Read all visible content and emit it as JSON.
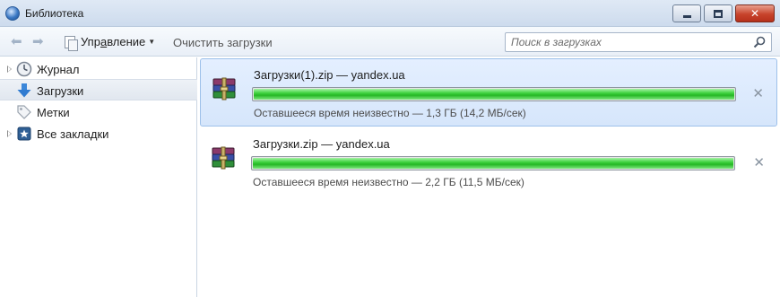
{
  "window": {
    "title": "Библиотека"
  },
  "toolbar": {
    "back_icon": "arrow-left-icon",
    "forward_icon": "arrow-right-icon",
    "manage_label": "Упр",
    "manage_label_underlined": "а",
    "manage_label_rest": "вление",
    "clear_label": "Очистить загрузки",
    "search_placeholder": "Поиск в загрузках"
  },
  "sidebar": {
    "items": [
      {
        "label": "Журнал",
        "icon": "clock-icon",
        "expandable": true,
        "selected": false
      },
      {
        "label": "Загрузки",
        "icon": "download-arrow-icon",
        "expandable": false,
        "selected": true
      },
      {
        "label": "Метки",
        "icon": "tag-icon",
        "expandable": false,
        "selected": false
      },
      {
        "label": "Все закладки",
        "icon": "star-bookmark-icon",
        "expandable": true,
        "selected": false
      }
    ]
  },
  "downloads": [
    {
      "name": "Загрузки(1).zip — yandex.ua",
      "status": "Оставшееся время неизвестно — 1,3 ГБ (14,2 МБ/сек)",
      "progress": 1.0,
      "selected": true,
      "icon": "winrar-archive-icon"
    },
    {
      "name": "Загрузки.zip — yandex.ua",
      "status": "Оставшееся время неизвестно — 2,2 ГБ (11,5 МБ/сек)",
      "progress": 1.0,
      "selected": false,
      "icon": "winrar-archive-icon"
    }
  ],
  "colors": {
    "progress_green": "#25b725",
    "selection_blue": "#d6e6fb",
    "close_red": "#c7432b"
  }
}
